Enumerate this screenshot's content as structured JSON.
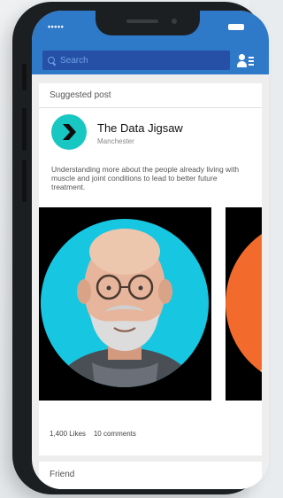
{
  "status_bar": {
    "signal": "•••••"
  },
  "search": {
    "placeholder": "Search"
  },
  "post": {
    "header": "Suggested post",
    "page_name": "The Data Jigsaw",
    "location": "Manchester",
    "text": "Understanding more about the people already living with muscle and joint conditions to lead to better future treatment.",
    "likes": "1,400 Likes",
    "comments": "10 comments"
  },
  "next_card": {
    "label": "Friend"
  },
  "colors": {
    "accent_blue": "#2f79c9",
    "search_bg": "#2650a6",
    "logo_teal": "#18c7c2",
    "photo_cyan": "#17c6e0",
    "photo_orange": "#f26b2c"
  },
  "icons": {
    "search": "search-icon",
    "profile": "profile-list-icon",
    "logo": "chevron-right-icon"
  }
}
